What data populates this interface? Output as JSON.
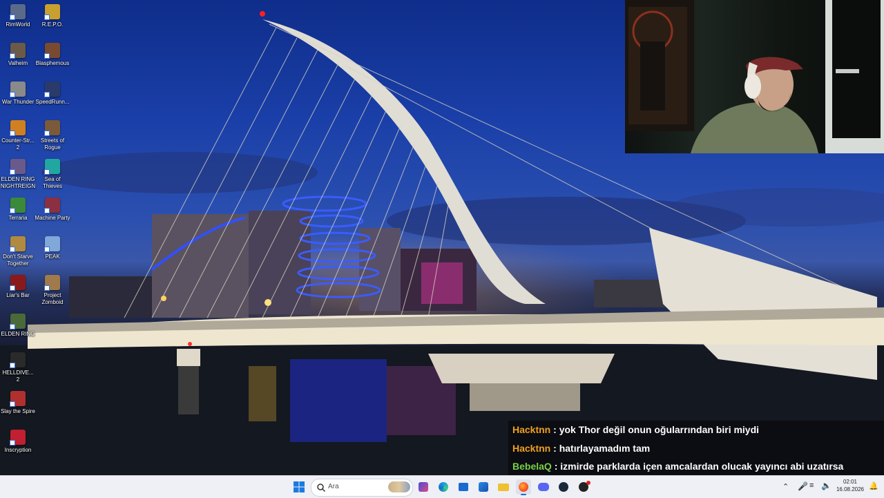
{
  "desktop": {
    "icons": [
      {
        "label": "RimWorld",
        "icon": "rimworld-icon",
        "color": "#5a6a8a"
      },
      {
        "label": "R.E.P.O.",
        "icon": "repo-icon",
        "color": "#c8a030"
      },
      {
        "label": "Valheim",
        "icon": "valheim-icon",
        "color": "#6b5a48"
      },
      {
        "label": "Blasphemous",
        "icon": "blasphemous-icon",
        "color": "#7a4a30"
      },
      {
        "label": "War Thunder",
        "icon": "war-thunder-icon",
        "color": "#8a8a8a"
      },
      {
        "label": "SpeedRunn...",
        "icon": "speedrunners-icon",
        "color": "#2a3a6a"
      },
      {
        "label": "Counter-Str... 2",
        "icon": "counter-strike-icon",
        "color": "#d08020"
      },
      {
        "label": "Streets of Rogue",
        "icon": "streets-of-rogue-icon",
        "color": "#7a5a3a"
      },
      {
        "label": "ELDEN RING NIGHTREIGN",
        "icon": "elden-ring-nightreign-icon",
        "color": "#6a5a8a"
      },
      {
        "label": "Sea of Thieves",
        "icon": "sea-of-thieves-icon",
        "color": "#20a8a0"
      },
      {
        "label": "Terraria",
        "icon": "terraria-icon",
        "color": "#3a8a3a"
      },
      {
        "label": "Machine Party",
        "icon": "machine-party-icon",
        "color": "#8a3040"
      },
      {
        "label": "Don't Starve Together",
        "icon": "dont-starve-icon",
        "color": "#b08a40"
      },
      {
        "label": "PEAK",
        "icon": "peak-icon",
        "color": "#80a8d8"
      },
      {
        "label": "Liar's Bar",
        "icon": "liars-bar-icon",
        "color": "#8a1a1a"
      },
      {
        "label": "Project Zomboid",
        "icon": "project-zomboid-icon",
        "color": "#a07a4a"
      },
      {
        "label": "ELDEN RING",
        "icon": "elden-ring-icon",
        "color": "#4a6a3a"
      },
      {
        "label": "HELLDIVE... 2",
        "icon": "helldivers-icon",
        "color": "#2a2a2a"
      },
      {
        "label": "Slay the Spire",
        "icon": "slay-the-spire-icon",
        "color": "#b03030"
      },
      {
        "label": "Inscryption",
        "icon": "inscryption-icon",
        "color": "#c02030"
      }
    ]
  },
  "chat": {
    "messages": [
      {
        "user": "Hacktnn",
        "user_color": "#f0a020",
        "text": "yok Thor değil onun oğularrından biri miydi"
      },
      {
        "user": "Hacktnn",
        "user_color": "#f0a020",
        "text": "hatırlayamadım tam"
      },
      {
        "user": "BebelaQ",
        "user_color": "#7ad04a",
        "text": "izmirde parklarda içen amcalardan olucak yayıncı abi uzatırsa"
      }
    ],
    "separator": " : "
  },
  "taskbar": {
    "search_placeholder": "Ara",
    "apps": [
      "windows-start-icon",
      "widgets-icon",
      "edge-icon",
      "store-icon",
      "outlook-icon",
      "file-explorer-icon",
      "firefox-icon",
      "discord-icon",
      "steam-icon",
      "game-launcher-icon"
    ],
    "time": "02:01",
    "date": "16.08.2026"
  }
}
